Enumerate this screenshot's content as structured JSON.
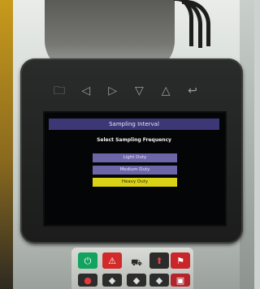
{
  "scene": "in-cab display monitor",
  "toolbar_keys": [
    {
      "icon": "folder-icon",
      "glyph": "🗀"
    },
    {
      "icon": "left-triangle-icon",
      "glyph": "◁"
    },
    {
      "icon": "right-triangle-icon",
      "glyph": "▷"
    },
    {
      "icon": "down-triangle-icon",
      "glyph": "▽"
    },
    {
      "icon": "up-triangle-icon",
      "glyph": "△"
    },
    {
      "icon": "return-arrow-icon",
      "glyph": "↩"
    }
  ],
  "screen": {
    "title": "Sampling Interval",
    "subtitle": "Select Sampling Frequency",
    "options": [
      {
        "label": "Light Duty",
        "color": "#6c66a8"
      },
      {
        "label": "Medium Duty",
        "color": "#6c66a8"
      },
      {
        "label": "Heavy Duty",
        "color": "#d9d217",
        "selected": true
      }
    ]
  },
  "keypad": {
    "buttons": [
      {
        "icon": "power-icon",
        "glyph": "⏻",
        "color": "#12a35e"
      },
      {
        "icon": "warning-icon",
        "glyph": "⚠",
        "color": "#d22a2a"
      },
      {
        "icon": "machine-icon",
        "glyph": "⛟",
        "color": "#2a2a2a"
      },
      {
        "icon": "arrow-icon",
        "glyph": "⬆",
        "color": "#2b2b2b"
      },
      {
        "icon": "alarm-icon",
        "glyph": "⚑",
        "color": "#c8262a"
      },
      {
        "icon": "dot-icon",
        "glyph": "●",
        "color": "#2c2c2c"
      },
      {
        "icon": "dot-icon",
        "glyph": "◆",
        "color": "#2c2c2c"
      },
      {
        "icon": "dot-icon",
        "glyph": "◆",
        "color": "#2c2c2c"
      },
      {
        "icon": "dot-icon",
        "glyph": "◆",
        "color": "#2c2c2c"
      },
      {
        "icon": "lock-icon",
        "glyph": "▣",
        "color": "#b4242a"
      }
    ]
  }
}
